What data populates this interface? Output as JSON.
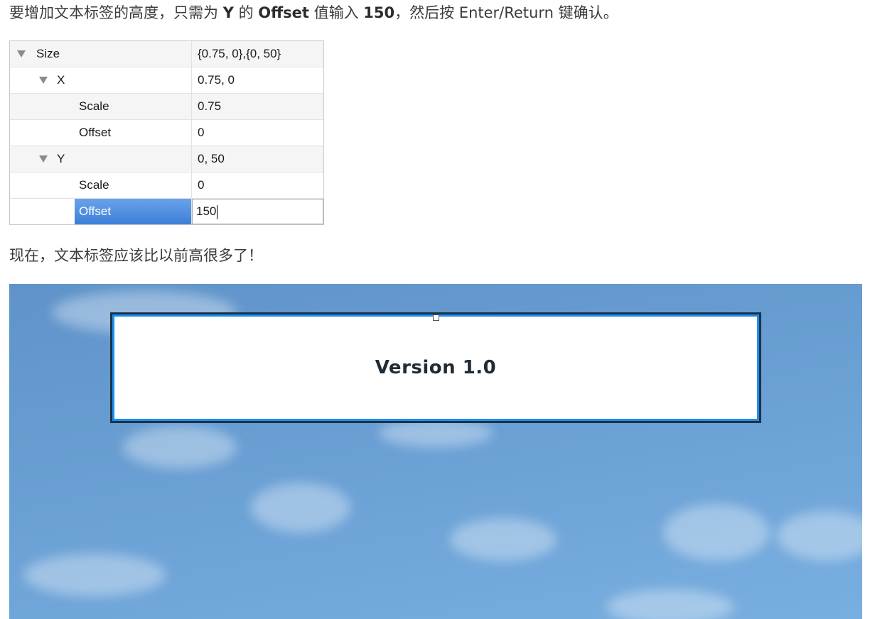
{
  "instructions": {
    "p1_before_y": "要增加文本标签的高度，只需为 ",
    "p1_y": "Y",
    "p1_de": " 的 ",
    "p1_offset": "Offset",
    "p1_mid": " 值输入 ",
    "p1_value": "150",
    "p1_after": "，然后按 Enter/Return 键确认。",
    "p2": "现在，文本标签应该比以前高很多了！"
  },
  "properties": {
    "size": {
      "label": "Size",
      "value": "{0.75, 0},{0, 50}"
    },
    "x": {
      "label": "X",
      "value": "0.75, 0"
    },
    "x_scale": {
      "label": "Scale",
      "value": "0.75"
    },
    "x_offset": {
      "label": "Offset",
      "value": "0"
    },
    "y": {
      "label": "Y",
      "value": "0, 50"
    },
    "y_scale": {
      "label": "Scale",
      "value": "0"
    },
    "y_offset": {
      "label": "Offset",
      "value": "150"
    }
  },
  "preview": {
    "label_text": "Version 1.0"
  },
  "colors": {
    "selection": "#3c7fd8",
    "label_border": "#1e8ef0",
    "label_frame": "#1a3348",
    "sky": "#6a9fd4"
  },
  "icons": {
    "expand": "triangle-down-icon",
    "resize_handle": "square-handle-icon"
  }
}
